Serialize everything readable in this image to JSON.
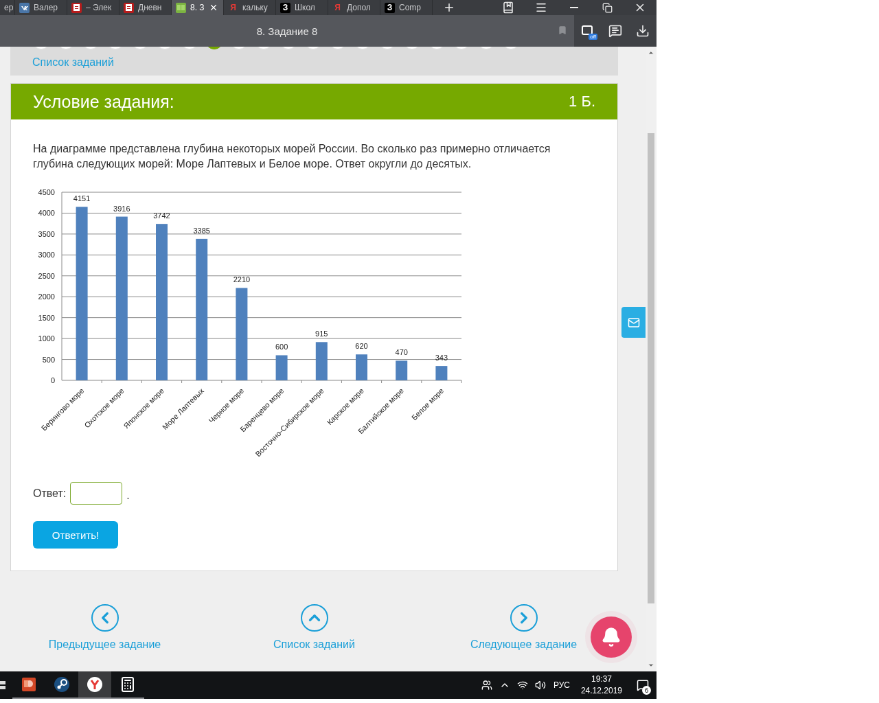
{
  "browser": {
    "tabs": [
      {
        "label": "ер",
        "kind": "plain",
        "selected": false
      },
      {
        "label": "Валер",
        "kind": "vk",
        "selected": false
      },
      {
        "label": "– Элек",
        "kind": "doc",
        "selected": false
      },
      {
        "label": "Дневн",
        "kind": "doc",
        "selected": false
      },
      {
        "label": "8. З",
        "kind": "book",
        "selected": true
      },
      {
        "label": "кальку",
        "kind": "ya",
        "glyph": "Я",
        "selected": false
      },
      {
        "label": "Школ",
        "kind": "z",
        "glyph": "З",
        "selected": false
      },
      {
        "label": "Допол",
        "kind": "ya",
        "glyph": "Я",
        "selected": false
      },
      {
        "label": "Comp",
        "kind": "z",
        "glyph": "З",
        "selected": false
      }
    ],
    "extension_badge": "off",
    "page_title": "8. Задание 8"
  },
  "task_dots": [
    {
      "selected": false
    },
    {
      "selected": false
    },
    {
      "selected": false
    },
    {
      "selected": false
    },
    {
      "selected": false
    },
    {
      "selected": false
    },
    {
      "selected": false
    },
    {
      "selected": true
    },
    {
      "selected": false
    },
    {
      "selected": false
    },
    {
      "selected": false
    },
    {
      "selected": false
    },
    {
      "selected": false
    },
    {
      "selected": false
    },
    {
      "selected": false
    },
    {
      "selected": false
    },
    {
      "selected": false
    },
    {
      "selected": false
    },
    {
      "selected": false
    },
    {
      "selected": false
    }
  ],
  "task_list_link": "Список заданий",
  "task": {
    "heading": "Условие задания:",
    "points": "1 Б.",
    "question": "На диаграмме представлена глубина некоторых морей России. Во сколько раз примерно отличается глубина следующих морей: Море Лаптевых и  Белое море. Ответ округли до десятых.",
    "chart_data": {
      "type": "bar",
      "categories": [
        "Берингово море",
        "Охотское море",
        "Японское море",
        "Море Лаптевых",
        "Черное море",
        "Баренцево море",
        "Восточно-Сибирское море",
        "Карское море",
        "Балтийское море",
        "Белое море"
      ],
      "values": [
        4151,
        3916,
        3742,
        3385,
        2210,
        600,
        915,
        620,
        470,
        343
      ],
      "ylim": [
        0,
        4500
      ],
      "yticks": [
        0,
        500,
        1000,
        1500,
        2000,
        2500,
        3000,
        3500,
        4000,
        4500
      ],
      "data_labels": true,
      "grid": true
    },
    "answer_label": "Ответ:",
    "answer_suffix": ".",
    "submit": "Ответить!"
  },
  "footer_nav": [
    {
      "kind": "prev",
      "label": "Предыдущее задание"
    },
    {
      "kind": "list",
      "label": "Список заданий"
    },
    {
      "kind": "next",
      "label": "Следующее задание"
    }
  ],
  "taskbar": {
    "apps": [
      {
        "kind": "slides",
        "active": false
      },
      {
        "kind": "steam",
        "active": false
      },
      {
        "kind": "browser",
        "active": true
      },
      {
        "kind": "calculator",
        "active": false
      }
    ],
    "language": "РУС",
    "time": "19:37",
    "date": "24.12.2019",
    "notifications": "6"
  }
}
